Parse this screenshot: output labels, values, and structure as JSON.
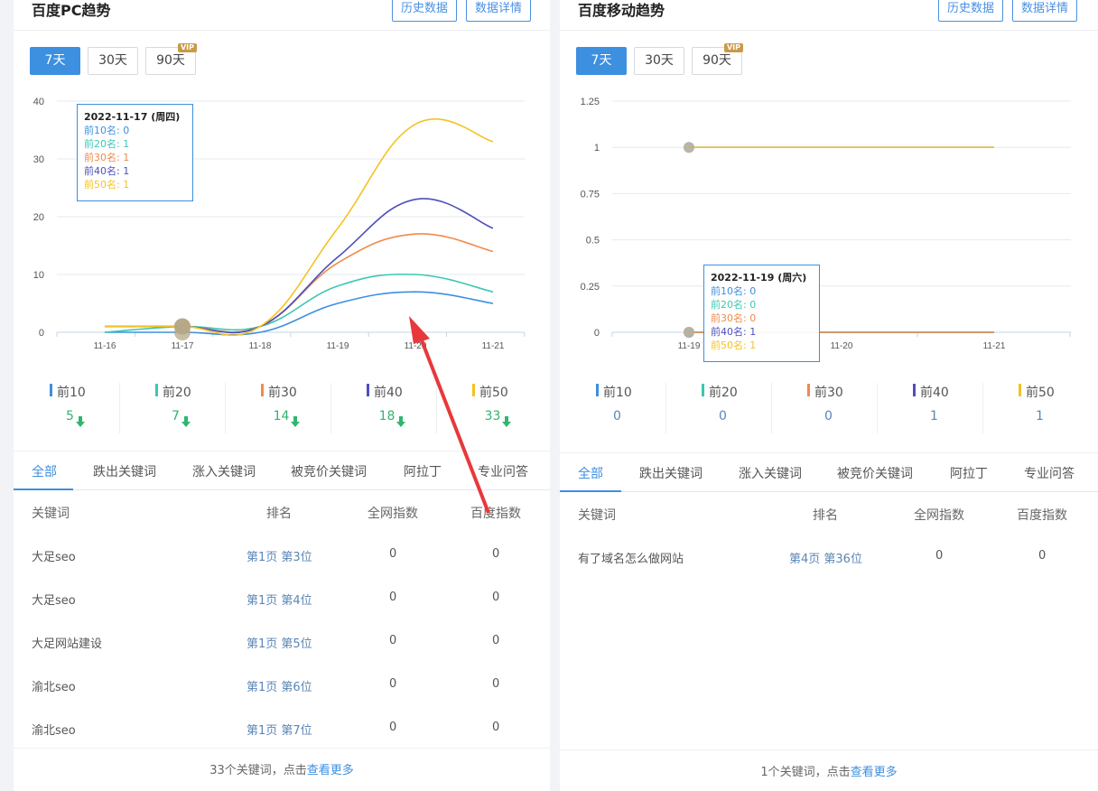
{
  "pc": {
    "title": "百度PC趋势",
    "history_btn": "历史数据",
    "detail_btn": "数据详情",
    "ranges": [
      "7天",
      "30天",
      "90天"
    ],
    "vip_badge": "VIP",
    "tooltip": {
      "title": "2022-11-17 (周四)",
      "rows": [
        "前10名: 0",
        "前20名: 1",
        "前30名: 1",
        "前40名: 1",
        "前50名: 1"
      ]
    },
    "stats": [
      {
        "label": "前10",
        "value": "5",
        "color": "#3d8fe0"
      },
      {
        "label": "前20",
        "value": "7",
        "color": "#3cc7b3"
      },
      {
        "label": "前30",
        "value": "14",
        "color": "#f08a4b"
      },
      {
        "label": "前40",
        "value": "18",
        "color": "#4d4fbd"
      },
      {
        "label": "前50",
        "value": "33",
        "color": "#f5c222"
      }
    ],
    "tabs": [
      "全部",
      "跌出关键词",
      "涨入关键词",
      "被竞价关键词",
      "阿拉丁",
      "专业问答"
    ],
    "table_headers": [
      "关键词",
      "排名",
      "全网指数",
      "百度指数"
    ],
    "rows": [
      {
        "keyword": "大足seo",
        "rank": "第1页 第3位",
        "net": "0",
        "baidu": "0"
      },
      {
        "keyword": "大足seo",
        "rank": "第1页 第4位",
        "net": "0",
        "baidu": "0"
      },
      {
        "keyword": "大足网站建设",
        "rank": "第1页 第5位",
        "net": "0",
        "baidu": "0"
      },
      {
        "keyword": "渝北seo",
        "rank": "第1页 第6位",
        "net": "0",
        "baidu": "0"
      },
      {
        "keyword": "渝北seo",
        "rank": "第1页 第7位",
        "net": "0",
        "baidu": "0"
      }
    ],
    "footer_text": "33个关键词，点击",
    "footer_link": "查看更多"
  },
  "mobile": {
    "title": "百度移动趋势",
    "history_btn": "历史数据",
    "detail_btn": "数据详情",
    "ranges": [
      "7天",
      "30天",
      "90天"
    ],
    "vip_badge": "VIP",
    "tooltip": {
      "title": "2022-11-19 (周六)",
      "rows": [
        "前10名: 0",
        "前20名: 0",
        "前30名: 0",
        "前40名: 1",
        "前50名: 1"
      ]
    },
    "stats": [
      {
        "label": "前10",
        "value": "0",
        "color": "#3d8fe0"
      },
      {
        "label": "前20",
        "value": "0",
        "color": "#3cc7b3"
      },
      {
        "label": "前30",
        "value": "0",
        "color": "#f08a4b"
      },
      {
        "label": "前40",
        "value": "1",
        "color": "#4d4fbd"
      },
      {
        "label": "前50",
        "value": "1",
        "color": "#f5c222"
      }
    ],
    "tabs": [
      "全部",
      "跌出关键词",
      "涨入关键词",
      "被竞价关键词",
      "阿拉丁",
      "专业问答"
    ],
    "table_headers": [
      "关键词",
      "排名",
      "全网指数",
      "百度指数"
    ],
    "rows": [
      {
        "keyword": "有了域名怎么做网站",
        "rank": "第4页 第36位",
        "net": "0",
        "baidu": "0"
      }
    ],
    "footer_text": "1个关键词，点击",
    "footer_link": "查看更多"
  },
  "chart_data": [
    {
      "type": "line",
      "x": [
        "11-16",
        "11-17",
        "11-18",
        "11-19",
        "11-20",
        "11-21"
      ],
      "ylim": [
        0,
        40
      ],
      "yticks": [
        0,
        10,
        20,
        30,
        40
      ],
      "grid": true,
      "series": [
        {
          "name": "前10",
          "color": "#3d8fe0",
          "values": [
            0,
            0,
            0,
            5,
            7,
            5
          ]
        },
        {
          "name": "前20",
          "color": "#3cc7b3",
          "values": [
            0,
            1,
            1,
            8,
            10,
            7
          ]
        },
        {
          "name": "前30",
          "color": "#f08a4b",
          "values": [
            1,
            1,
            1,
            12,
            17,
            14
          ]
        },
        {
          "name": "前40",
          "color": "#4d4fbd",
          "values": [
            1,
            1,
            1,
            13,
            23,
            18
          ]
        },
        {
          "name": "前50",
          "color": "#f5c222",
          "values": [
            1,
            1,
            1,
            18,
            36,
            33
          ]
        }
      ]
    },
    {
      "type": "line",
      "x": [
        "11-19",
        "11-20",
        "11-21"
      ],
      "ylim": [
        0,
        1.25
      ],
      "yticks": [
        0,
        0.25,
        0.5,
        0.75,
        1,
        1.25
      ],
      "grid": true,
      "series": [
        {
          "name": "前10",
          "color": "#3d8fe0",
          "values": [
            0,
            0,
            0
          ]
        },
        {
          "name": "前20",
          "color": "#3cc7b3",
          "values": [
            0,
            0,
            0
          ]
        },
        {
          "name": "前30",
          "color": "#f08a4b",
          "values": [
            0,
            0,
            0
          ]
        },
        {
          "name": "前40",
          "color": "#4d4fbd",
          "values": [
            1,
            1,
            1
          ]
        },
        {
          "name": "前50",
          "color": "#f5c222",
          "values": [
            1,
            1,
            1
          ]
        }
      ]
    }
  ]
}
